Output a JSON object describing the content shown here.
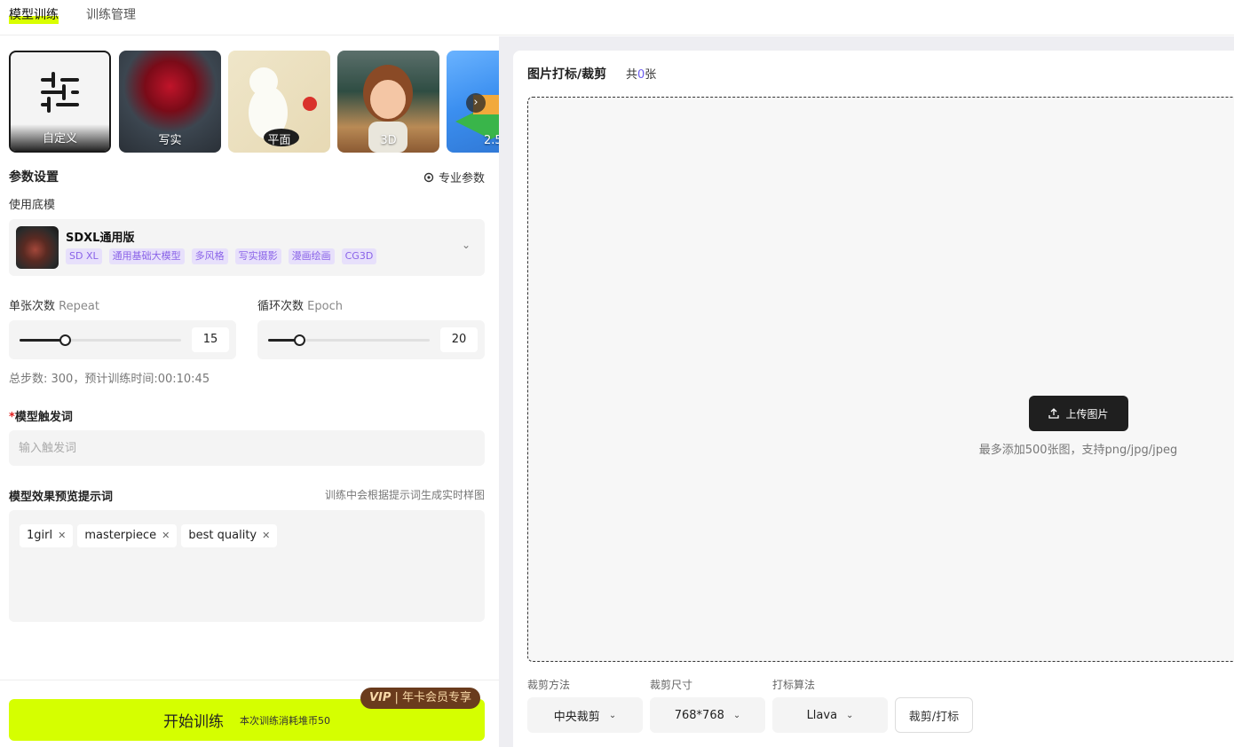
{
  "topnav": {
    "tabs": [
      "模型训练",
      "训练管理"
    ]
  },
  "styles": [
    {
      "label": "自定义",
      "icon": "sliders-icon"
    },
    {
      "label": "写实"
    },
    {
      "label": "平面"
    },
    {
      "label": "3D"
    },
    {
      "label": "2.5"
    }
  ],
  "params": {
    "title": "参数设置",
    "pro_link": "专业参数",
    "base_model_label": "使用底模",
    "base_model": {
      "name": "SDXL通用版",
      "tags": [
        "SD XL",
        "通用基础大模型",
        "多风格",
        "写实摄影",
        "漫画绘画",
        "CG3D"
      ]
    },
    "repeat": {
      "label": "单张次数",
      "label_en": "Repeat",
      "value": "15",
      "fraction": 0.28
    },
    "epoch": {
      "label": "循环次数",
      "label_en": "Epoch",
      "value": "20",
      "fraction": 0.19
    },
    "steps_info": "总步数: 300，预计训练时间:00:10:45"
  },
  "trigger": {
    "required_mark": "*",
    "label": "模型触发词",
    "placeholder": "输入触发词"
  },
  "preview": {
    "label": "模型效果预览提示词",
    "hint": "训练中会根据提示词生成实时样图",
    "chips": [
      "1girl",
      "masterpiece",
      "best quality"
    ]
  },
  "start": {
    "button": "开始训练",
    "cost": "本次训练消耗堆币50",
    "vip_mark": "VIP",
    "vip_text": "| 年卡会员专享"
  },
  "images": {
    "title": "图片打标/裁剪",
    "count_prefix": "共",
    "count": "0",
    "count_suffix": "张",
    "upload_button": "上传图片",
    "upload_hint": "最多添加500张图，支持png/jpg/jpeg"
  },
  "controls": {
    "crop_method_label": "裁剪方法",
    "crop_method": "中央裁剪",
    "crop_size_label": "裁剪尺寸",
    "crop_size": "768*768",
    "tag_algo_label": "打标算法",
    "tag_algo": "Llava",
    "crop_tag_button": "裁剪/打标"
  },
  "colors": {
    "accent": "#d5ff00",
    "tag_purple": "#8a63e8",
    "dark": "#1f1f1f",
    "vip_brown": "#6a3b1d"
  }
}
